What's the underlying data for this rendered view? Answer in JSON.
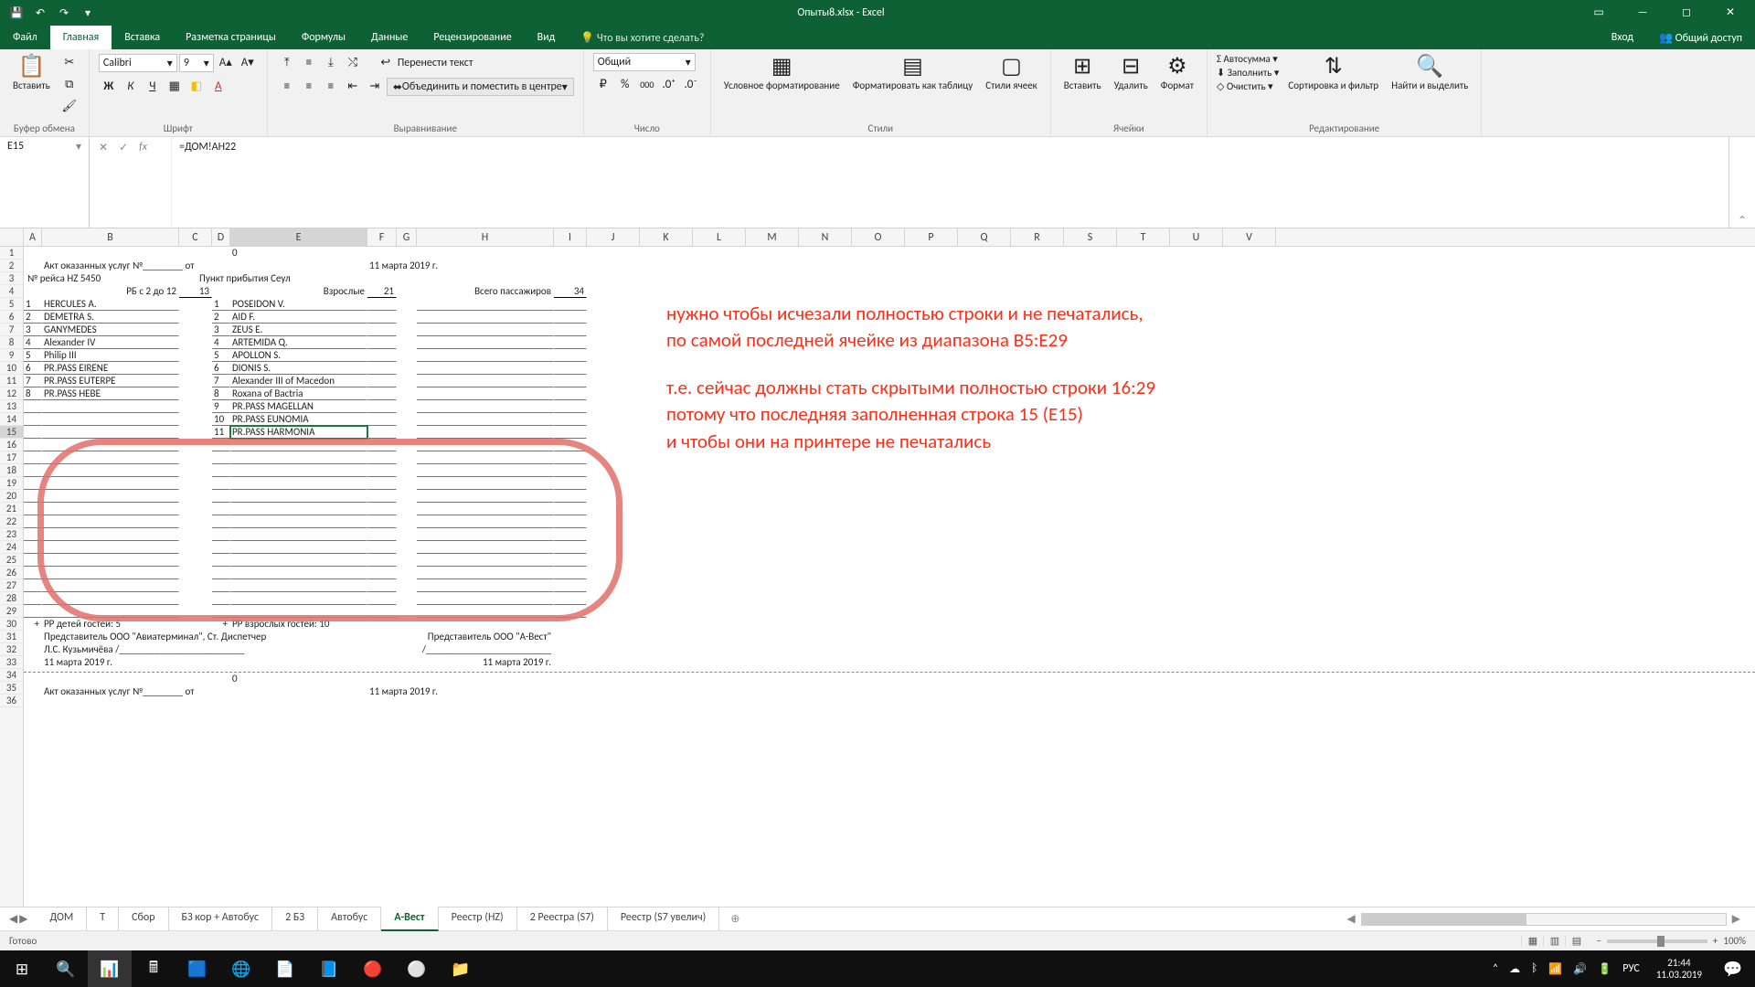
{
  "app": {
    "title": "Опыты8.xlsx - Excel"
  },
  "qat": {
    "save": "💾",
    "undo": "↶",
    "redo": "↷"
  },
  "tabs": {
    "file": "Файл",
    "items": [
      "Главная",
      "Вставка",
      "Разметка страницы",
      "Формулы",
      "Данные",
      "Рецензирование",
      "Вид"
    ],
    "active": 0,
    "tell": "Что вы хотите сделать?",
    "signin": "Вход",
    "share": "Общий доступ"
  },
  "ribbonGroups": {
    "clipboard": "Буфер обмена",
    "font": "Шрифт",
    "align": "Выравнивание",
    "number": "Число",
    "styles": "Стили",
    "cells": "Ячейки",
    "editing": "Редактирование"
  },
  "font": {
    "name": "Calibri",
    "size": "9"
  },
  "align": {
    "wrap": "Перенести текст",
    "merge": "Объединить и поместить в центре"
  },
  "numfmt": "Общий",
  "btns": {
    "paste": "Вставить",
    "condfmt": "Условное форматирование",
    "fmttable": "Форматировать как таблицу",
    "cellstyle": "Стили ячеек",
    "insert": "Вставить",
    "delete": "Удалить",
    "format": "Формат",
    "autosum": "Автосумма",
    "fill": "Заполнить",
    "clear": "Очистить",
    "sort": "Сортировка и фильтр",
    "find": "Найти и выделить"
  },
  "namebox": "E15",
  "formula": "=ДОМ!AH22",
  "cols": [
    "A",
    "B",
    "C",
    "D",
    "E",
    "F",
    "G",
    "H",
    "I",
    "J",
    "K",
    "L",
    "M",
    "N",
    "O",
    "P",
    "Q",
    "R",
    "S",
    "T",
    "U",
    "V"
  ],
  "sheet": {
    "r1": {
      "E": "0"
    },
    "r2": {
      "B": "Акт оказанных услуг №________ от",
      "F": "11 марта 2019 г."
    },
    "r3": {
      "A": "№ рейса HZ 5450",
      "D": "Пункт прибытия Сеул"
    },
    "r4": {
      "B": "РБ с 2 до 12",
      "C": "13",
      "E": "Взрослые",
      "F": "21",
      "H": "Всего пассажиров",
      "I": "34"
    },
    "rowsLeft": [
      {
        "n": "1",
        "name": "HERCULES A."
      },
      {
        "n": "2",
        "name": "DEMETRA S."
      },
      {
        "n": "3",
        "name": "GANYMEDES"
      },
      {
        "n": "4",
        "name": "Alexander IV"
      },
      {
        "n": "5",
        "name": "Philip III"
      },
      {
        "n": "6",
        "name": "PR.PASS EIRENE"
      },
      {
        "n": "7",
        "name": "PR.PASS EUTERPE"
      },
      {
        "n": "8",
        "name": "PR.PASS HEBE"
      }
    ],
    "rowsRight": [
      {
        "n": "1",
        "name": "POSEIDON V."
      },
      {
        "n": "2",
        "name": "AID F."
      },
      {
        "n": "3",
        "name": "ZEUS E."
      },
      {
        "n": "4",
        "name": "ARTEMIDA Q."
      },
      {
        "n": "5",
        "name": "APOLLON S."
      },
      {
        "n": "6",
        "name": "DIONIS S."
      },
      {
        "n": "7",
        "name": "Alexander III of Macedon"
      },
      {
        "n": "8",
        "name": "Roxana of Bactria"
      },
      {
        "n": "9",
        "name": "PR.PASS MAGELLAN"
      },
      {
        "n": "10",
        "name": "PR.PASS EUNOMIA"
      },
      {
        "n": "11",
        "name": "PR.PASS HARMONIA"
      }
    ],
    "r30": {
      "A": "+",
      "B": "РР детей гостей: 5",
      "D": "+",
      "E": "РР взрослых гостей: 10"
    },
    "r31": {
      "B": "Представитель ООО \"Авиатерминал\", Ст. Диспетчер",
      "H": "Представитель ООО \"А-Вест\""
    },
    "r32": {
      "B": "Л.С. Кузьмичёва /_________________________",
      "H": "/_________________________"
    },
    "r33": {
      "B": "11 марта 2019 г.",
      "H": "11 марта 2019 г."
    },
    "r35": {
      "E": "0"
    },
    "r36": {
      "B": "Акт оказанных услуг №________ от",
      "F": "11 марта 2019 г."
    }
  },
  "annot": {
    "l1": "нужно чтобы исчезали полностью строки и не печатались,",
    "l2": "по самой последней ячейке из диапазона В5:Е29",
    "l3": "т.е. сейчас должны стать скрытыми полностью строки 16:29",
    "l4": "потому что последняя заполненная строка 15 (E15)",
    "l5": "и чтобы они на принтере не печатались"
  },
  "sheettabs": {
    "items": [
      "ДОМ",
      "Т",
      "Сбор",
      "БЗ кор + Автобус",
      "2 БЗ",
      "Автобус",
      "А-Вест",
      "Реестр (HZ)",
      "2 Реестра (S7)",
      "Реестр (S7 увелич)"
    ],
    "active": 6
  },
  "status": {
    "ready": "Готово",
    "zoom": "100%"
  },
  "task": {
    "lang": "РУС",
    "time": "21:44",
    "date": "11.03.2019"
  }
}
